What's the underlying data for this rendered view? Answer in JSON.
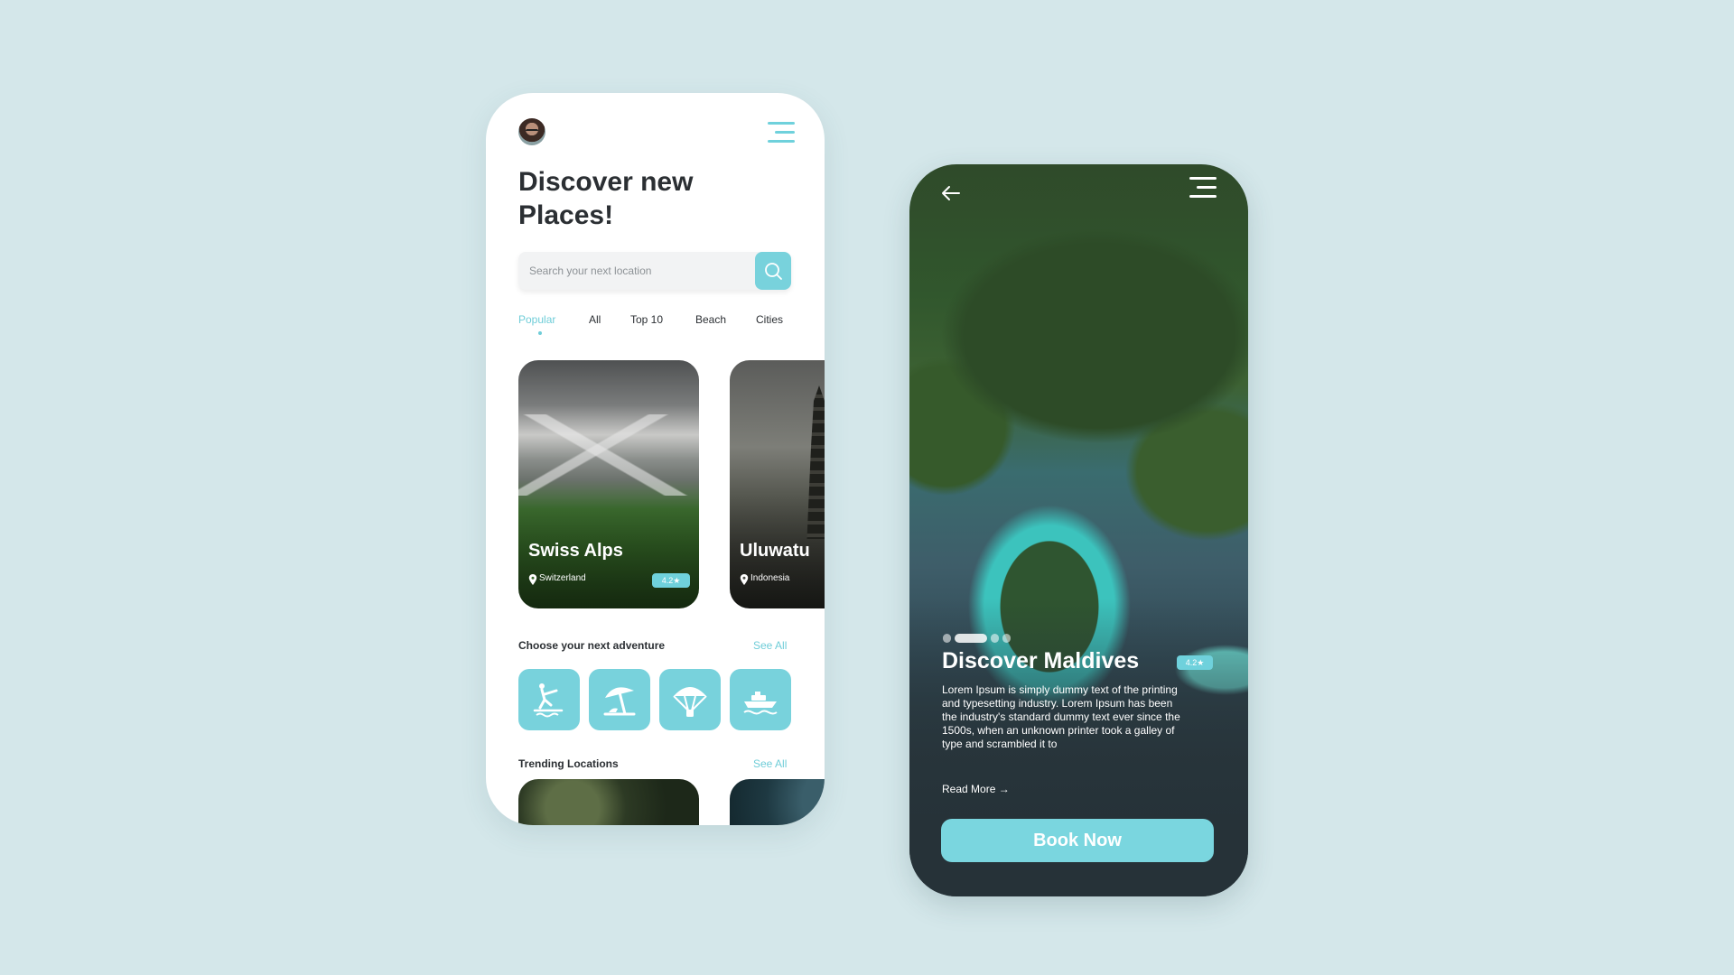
{
  "colors": {
    "accent": "#78d2dc",
    "background": "#d4e7ea",
    "text": "#2b2f33"
  },
  "home": {
    "title": "Discover new Places!",
    "search": {
      "placeholder": "Search your next location",
      "value": ""
    },
    "tabs": [
      {
        "label": "Popular",
        "active": true
      },
      {
        "label": "All"
      },
      {
        "label": "Top 10"
      },
      {
        "label": "Beach"
      },
      {
        "label": "Cities"
      }
    ],
    "places": [
      {
        "name": "Swiss Alps",
        "location": "Switzerland",
        "rating": "4.2★"
      },
      {
        "name": "Uluwatu",
        "location": "Indonesia"
      }
    ],
    "adventure": {
      "title": "Choose your next adventure",
      "see_all": "See All",
      "icons": [
        "water-ski-icon",
        "beach-umbrella-icon",
        "parachute-icon",
        "boat-icon"
      ]
    },
    "trending": {
      "title": "Trending Locations",
      "see_all": "See All"
    }
  },
  "detail": {
    "title": "Discover Maldives",
    "rating": "4.2★",
    "description": "Lorem Ipsum is simply dummy text of the printing and typesetting industry. Lorem Ipsum has been the industry's standard dummy text ever since the 1500s, when an unknown printer took a galley of type and scrambled it to",
    "read_more": "Read More →",
    "book_label": "Book Now"
  }
}
